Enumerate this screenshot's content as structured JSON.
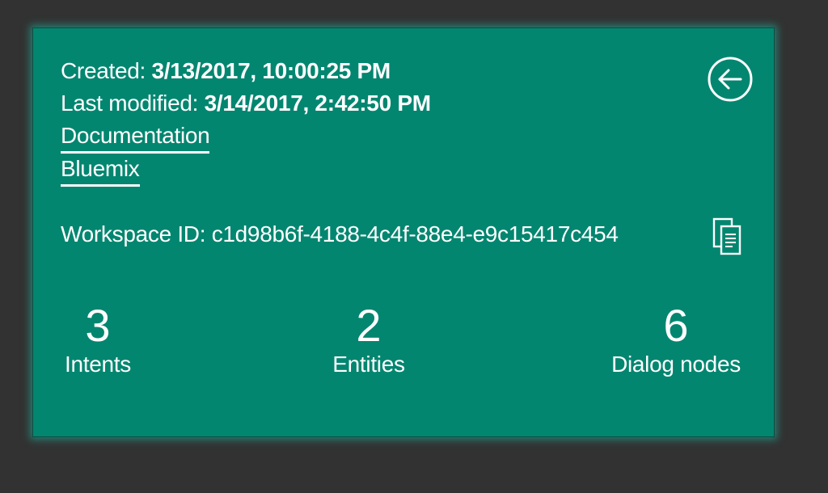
{
  "meta": {
    "created_label": "Created: ",
    "created_value": "3/13/2017, 10:00:25 PM",
    "modified_label": "Last modified: ",
    "modified_value": "3/14/2017, 2:42:50 PM"
  },
  "links": {
    "documentation": "Documentation",
    "bluemix": "Bluemix"
  },
  "workspace": {
    "id_label": "Workspace ID: ",
    "id_value": "c1d98b6f-4188-4c4f-88e4-e9c15417c454"
  },
  "stats": [
    {
      "value": "3",
      "label": "Intents"
    },
    {
      "value": "2",
      "label": "Entities"
    },
    {
      "value": "6",
      "label": "Dialog nodes"
    }
  ],
  "icons": {
    "back": "back-arrow-icon",
    "copy": "copy-icon"
  },
  "colors": {
    "background": "#323232",
    "card": "#038670",
    "text": "#ffffff",
    "glow": "#21bea5"
  }
}
